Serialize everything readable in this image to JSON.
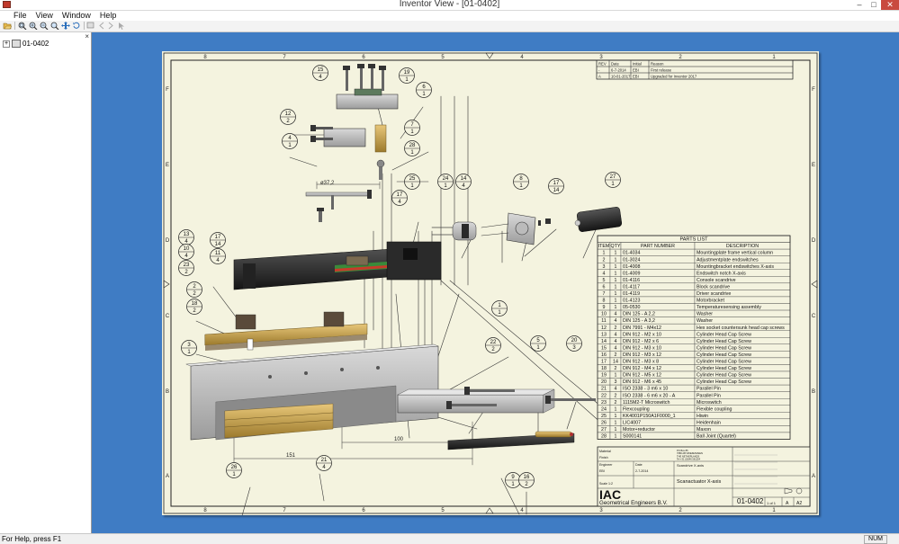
{
  "window": {
    "title": "Inventor View - [01-0402]",
    "minimize": "–",
    "maximize": "□",
    "close": "✕"
  },
  "menu": [
    "File",
    "View",
    "Window",
    "Help"
  ],
  "toolbar": {
    "icons": [
      "open-icon",
      "zoom-all-icon",
      "zoom-in-icon",
      "zoom-out-icon",
      "zoom-window-icon",
      "pan-icon",
      "rotate-icon",
      "display-icon",
      "back-icon",
      "forward-icon",
      "cursor-icon"
    ]
  },
  "tree": {
    "close": "×",
    "expander": "+",
    "root": "01-0402"
  },
  "status": {
    "message": "For Help, press F1",
    "num": "NUM"
  },
  "drawing": {
    "border_cols_top": [
      "8",
      "7",
      "6",
      "5",
      "4",
      "3",
      "2",
      "1"
    ],
    "border_rows": [
      "F",
      "E",
      "D",
      "C",
      "B",
      "A"
    ],
    "revisions": [
      [
        "REV",
        "Date",
        "Initial",
        "Reason"
      ],
      [
        "-",
        "6-7-2014",
        "EBI",
        "First release"
      ],
      [
        "A",
        "10-01-2017",
        "EBI",
        "Upgraded for Inventor 2017"
      ]
    ],
    "parts_list": {
      "title": "PARTS LIST",
      "headers": [
        "ITEM",
        "QTY",
        "PART NUMBER",
        "DESCRIPTION"
      ],
      "rows": [
        [
          "1",
          "1",
          "01-4034",
          "Mountingplate frame vertical column"
        ],
        [
          "2",
          "1",
          "01-3024",
          "Adjustmentplate endswitches"
        ],
        [
          "3",
          "1",
          "01-4008",
          "Mountingbracket endswitches X-axis"
        ],
        [
          "4",
          "1",
          "01-4009",
          "Endswitch notch X-axis"
        ],
        [
          "5",
          "1",
          "01-4116",
          "Console scandrive"
        ],
        [
          "6",
          "1",
          "01-4117",
          "Block scandrive"
        ],
        [
          "7",
          "1",
          "01-4119",
          "Driver scandrive"
        ],
        [
          "8",
          "1",
          "01-4123",
          "Motorbracket"
        ],
        [
          "9",
          "1",
          "05-0530",
          "Temperaturesensing assembly"
        ],
        [
          "10",
          "4",
          "DIN 125 - A 2,2",
          "Washer"
        ],
        [
          "11",
          "4",
          "DIN 125 - A 3,2",
          "Washer"
        ],
        [
          "12",
          "2",
          "DIN 7991 - M4x12",
          "Hex socket countersunk head cap screws"
        ],
        [
          "13",
          "4",
          "DIN 912 - M2 x 10",
          "Cylinder Head Cap Screw"
        ],
        [
          "14",
          "4",
          "DIN 912 - M2 x 6",
          "Cylinder Head Cap Screw"
        ],
        [
          "15",
          "4",
          "DIN 912 - M3 x 10",
          "Cylinder Head Cap Screw"
        ],
        [
          "16",
          "2",
          "DIN 912 - M3 x 12",
          "Cylinder Head Cap Screw"
        ],
        [
          "17",
          "14",
          "DIN 912 - M3 x 8",
          "Cylinder Head Cap Screw"
        ],
        [
          "18",
          "2",
          "DIN 912 - M4 x 12",
          "Cylinder Head Cap Screw"
        ],
        [
          "19",
          "1",
          "DIN 912 - M5 x 12",
          "Cylinder Head Cap Screw"
        ],
        [
          "20",
          "3",
          "DIN 912 - M6 x 45",
          "Cylinder Head Cap Screw"
        ],
        [
          "21",
          "4",
          "ISO 2338 - 3 m6 x 10",
          "Parallel Pin"
        ],
        [
          "22",
          "2",
          "ISO 2338 - 6 m6 x 20 - A",
          "Parallel Pin"
        ],
        [
          "23",
          "2",
          "1115M2-T Microswitch",
          "Microswitch"
        ],
        [
          "24",
          "1",
          "Flexcoupling",
          "Flexible coupling"
        ],
        [
          "25",
          "1",
          "KK4001P150A1F0000_1",
          "Hiwin"
        ],
        [
          "26",
          "1",
          "LIC4007",
          "Heidenhain"
        ],
        [
          "27",
          "1",
          "Motor+reductor",
          "Maxon"
        ],
        [
          "28",
          "1",
          "S000141",
          "Ball Joint (Quartel)"
        ]
      ]
    },
    "balloons": [
      [
        "15",
        "4"
      ],
      [
        "19",
        "1"
      ],
      [
        "6",
        "1"
      ],
      [
        "12",
        "2"
      ],
      [
        "4",
        "1"
      ],
      [
        "7",
        "1"
      ],
      [
        "28",
        "1"
      ],
      [
        "25",
        "1"
      ],
      [
        "24",
        "1"
      ],
      [
        "14",
        "4"
      ],
      [
        "8",
        "1"
      ],
      [
        "17",
        "14"
      ],
      [
        "27",
        "1"
      ],
      [
        "17",
        "4"
      ],
      [
        "13",
        "4"
      ],
      [
        "10",
        "4"
      ],
      [
        "23",
        "2"
      ],
      [
        "17",
        "14"
      ],
      [
        "11",
        "4"
      ],
      [
        "2",
        "2"
      ],
      [
        "18",
        "2"
      ],
      [
        "3",
        "1"
      ],
      [
        "1",
        "1"
      ],
      [
        "22",
        "2"
      ],
      [
        "5",
        "1"
      ],
      [
        "20",
        "3"
      ],
      [
        "26",
        "1"
      ],
      [
        "21",
        "4"
      ],
      [
        "9",
        "1"
      ],
      [
        "16",
        "2"
      ]
    ],
    "dims": [
      "ø37,2",
      "100",
      "151"
    ],
    "title_block": {
      "company_logo": "IAC",
      "company": "Geometrical Engineers B.V.",
      "address": [
        "PO Box 85",
        "7680 AB VRIEZENVEEN",
        "THE NETHERLANDS",
        "Tel +31 (0)546 561254"
      ],
      "designed_label": "Engineer",
      "designed_by": "EBI",
      "date_label": "Date",
      "date": "2-7-2014",
      "description": "Scanactuator X-axis",
      "subtitle": "Scandrive X-axis",
      "drawing_no": "01-0402",
      "sheet": "1 of 1",
      "rev": "A",
      "size": "A2",
      "scale_label": "Scale",
      "scale": "1:2",
      "material_label": "Material",
      "finish_label": "Finish"
    }
  }
}
